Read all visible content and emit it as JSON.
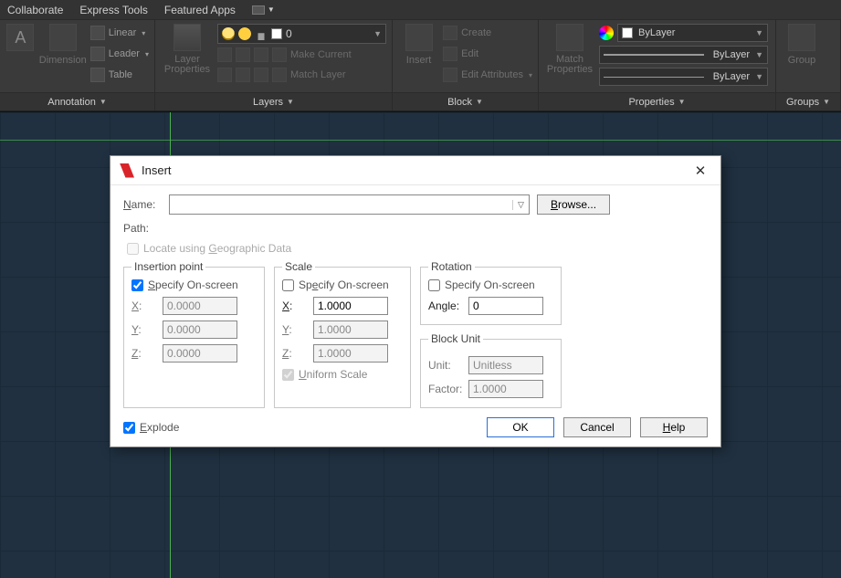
{
  "menubar": {
    "items": [
      "Collaborate",
      "Express Tools",
      "Featured Apps"
    ]
  },
  "ribbon": {
    "annotation": {
      "title": "Annotation",
      "big": "Dimension",
      "rows": [
        "Linear",
        "Leader",
        "Table"
      ]
    },
    "layers": {
      "title": "Layers",
      "big": "Layer Properties",
      "current_layer": "0",
      "rows": [
        "Make Current",
        "Match Layer"
      ]
    },
    "block": {
      "title": "Block",
      "big": "Insert",
      "rows": [
        "Create",
        "Edit",
        "Edit Attributes"
      ]
    },
    "properties": {
      "title": "Properties",
      "big": "Match Properties",
      "lines": [
        "ByLayer",
        "ByLayer",
        "ByLayer"
      ]
    },
    "groups": {
      "title": "Groups",
      "big": "Group"
    }
  },
  "dialog": {
    "title": "Insert",
    "name_label": "Name:",
    "name_value": "",
    "browse": "Browse...",
    "path_label": "Path:",
    "locate_geo": "Locate using Geographic Data",
    "explode": "Explode",
    "ok": "OK",
    "cancel": "Cancel",
    "help": "Help",
    "insertion": {
      "legend": "Insertion point",
      "specify": "Specify On-screen",
      "specify_checked": true,
      "x": "0.0000",
      "y": "0.0000",
      "z": "0.0000"
    },
    "scale": {
      "legend": "Scale",
      "specify": "Specify On-screen",
      "specify_checked": false,
      "x": "1.0000",
      "y": "1.0000",
      "z": "1.0000",
      "uniform": "Uniform Scale"
    },
    "rotation": {
      "legend": "Rotation",
      "specify": "Specify On-screen",
      "specify_checked": false,
      "angle_label": "Angle:",
      "angle": "0"
    },
    "blockunit": {
      "legend": "Block Unit",
      "unit_label": "Unit:",
      "unit": "Unitless",
      "factor_label": "Factor:",
      "factor": "1.0000"
    }
  }
}
